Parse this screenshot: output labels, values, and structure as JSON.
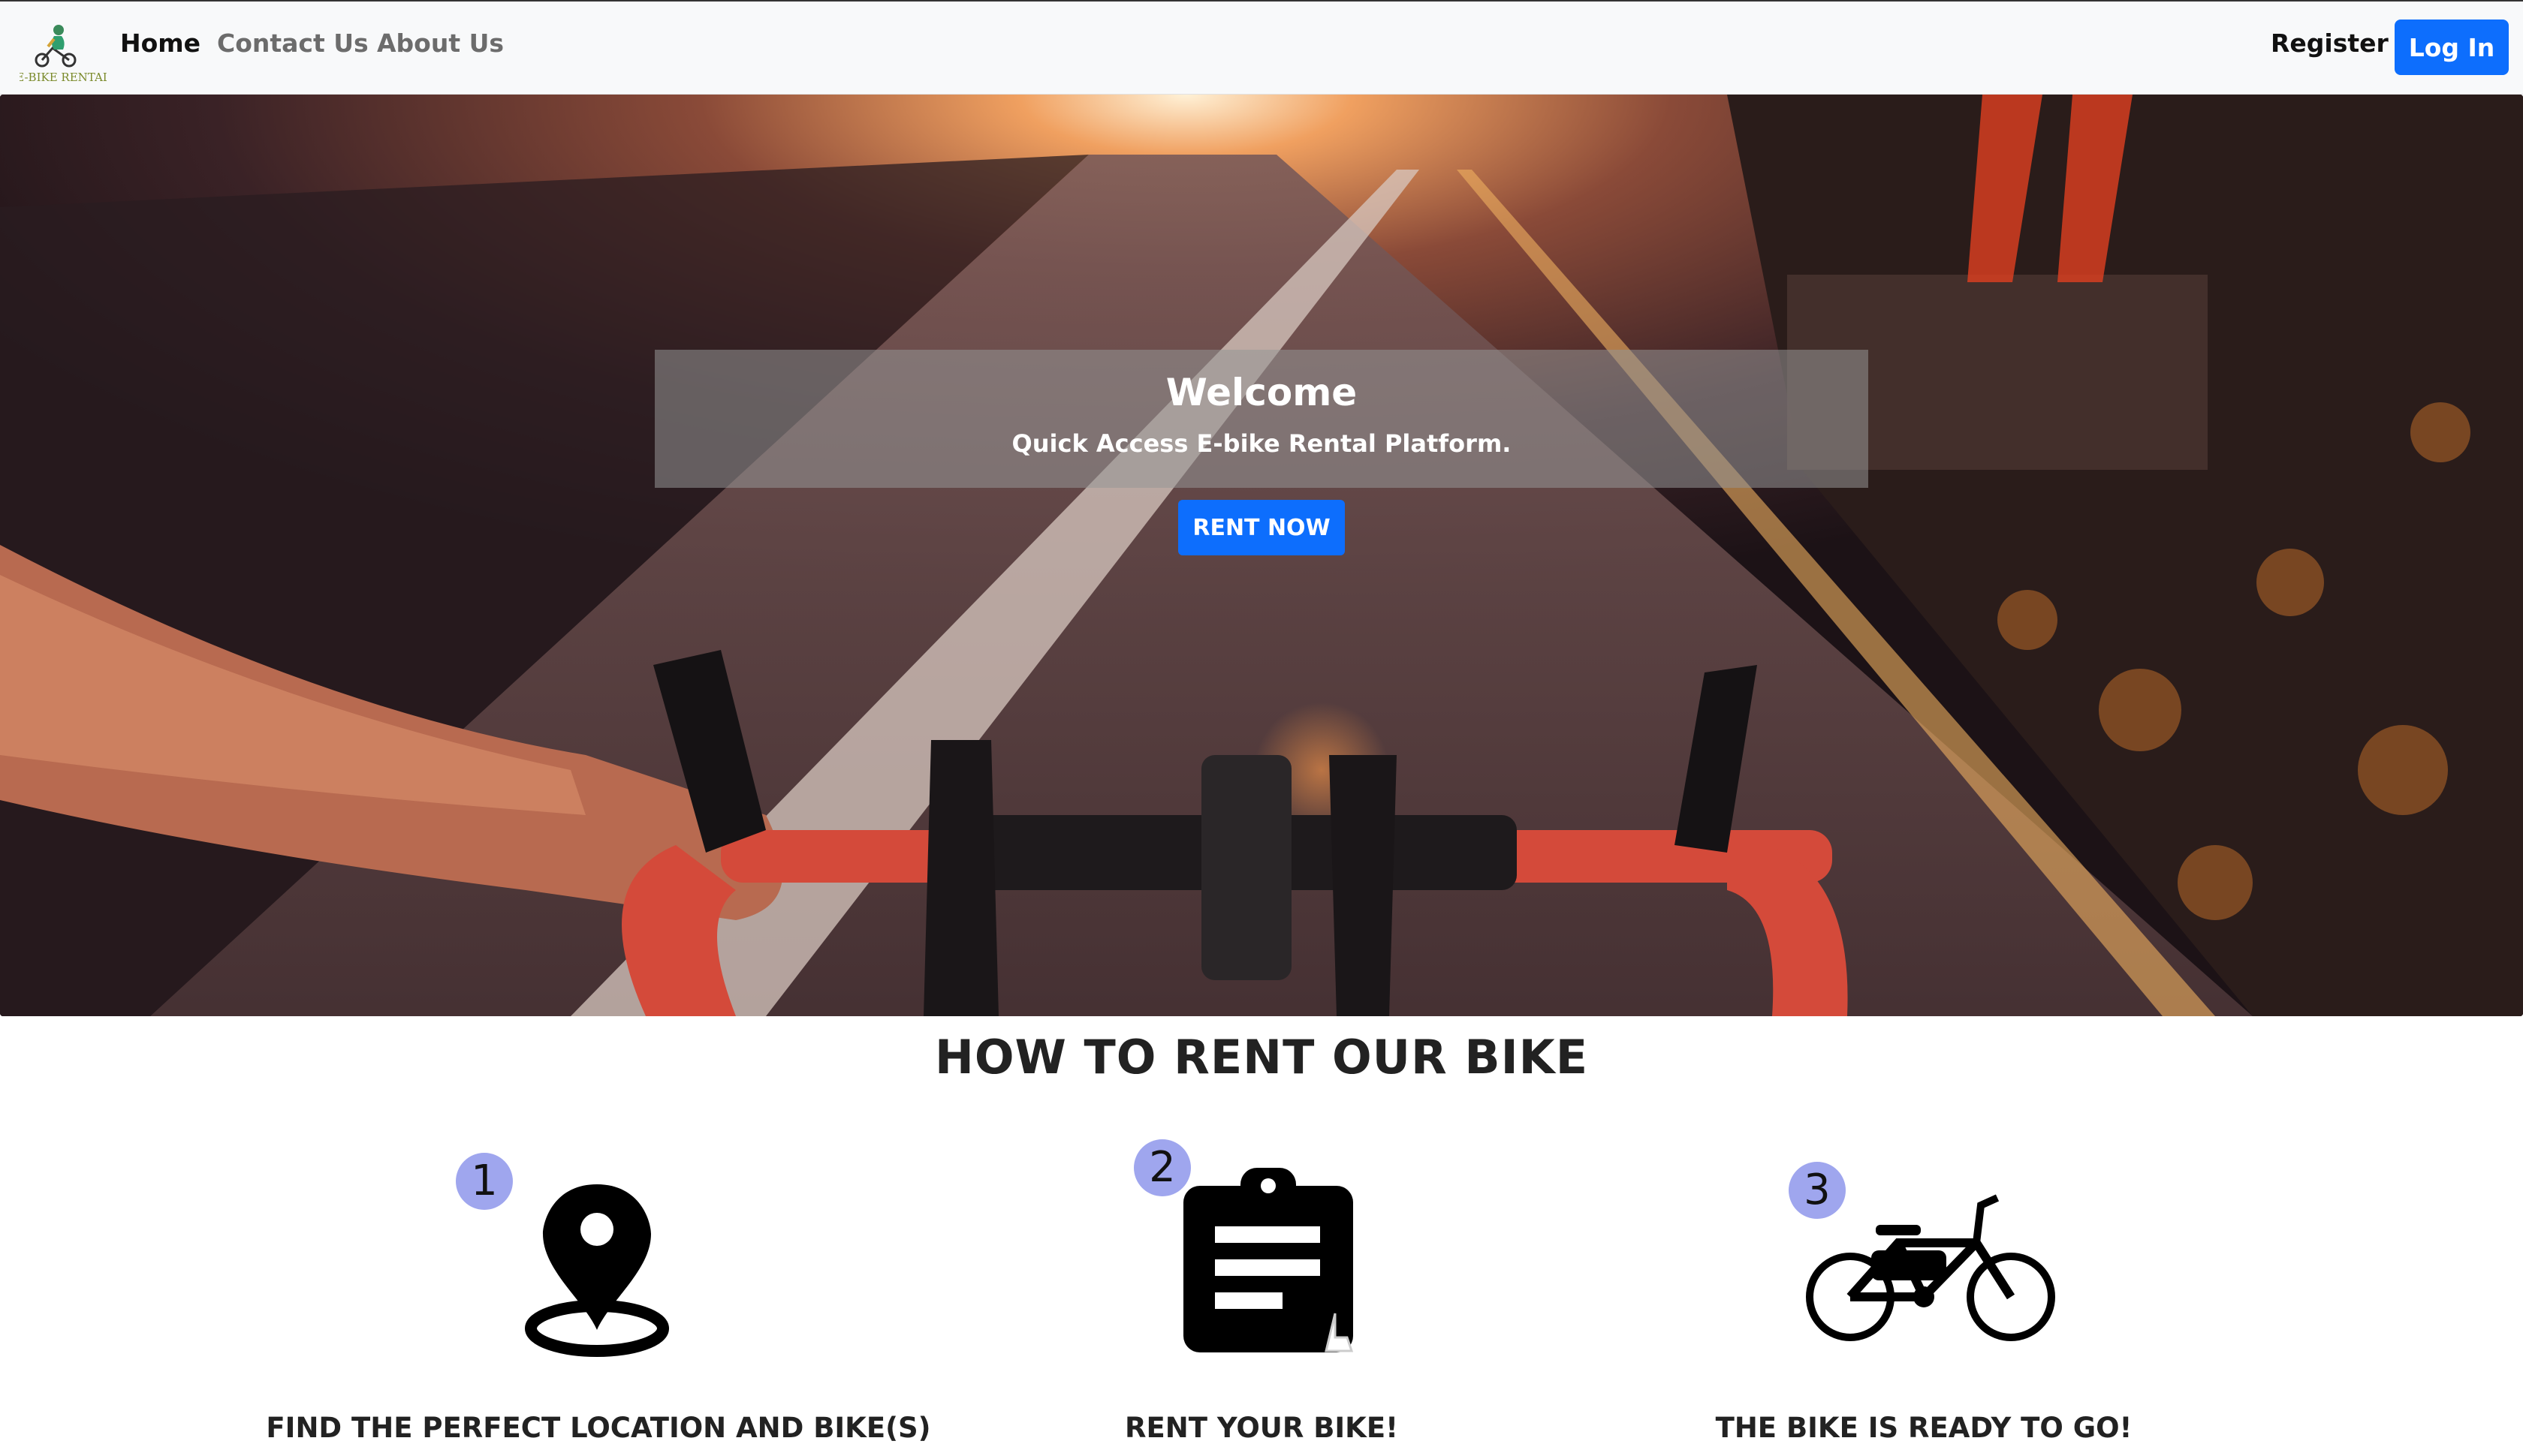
{
  "navbar": {
    "brand_text": "E-BIKE RENTAL",
    "links": {
      "home": "Home",
      "contact": "Contact Us",
      "about": "About Us"
    },
    "register_label": "Register",
    "login_label": "Log In"
  },
  "hero": {
    "title": "Welcome",
    "subtitle": "Quick Access E-bike Rental Platform.",
    "cta_label": "RENT NOW"
  },
  "how_to": {
    "title": "HOW TO RENT OUR BIKE",
    "steps": [
      {
        "number": "1",
        "icon": "location-pin-icon",
        "label": "FIND THE PERFECT LOCATION AND BIKE(S)"
      },
      {
        "number": "2",
        "icon": "clipboard-icon",
        "label": "RENT YOUR BIKE!"
      },
      {
        "number": "3",
        "icon": "bicycle-icon",
        "label": "THE BIKE IS READY TO GO!"
      }
    ]
  },
  "colors": {
    "primary": "#0d6efd",
    "badge": "#9fa6ee",
    "navbar_bg": "#f8f9fa"
  }
}
